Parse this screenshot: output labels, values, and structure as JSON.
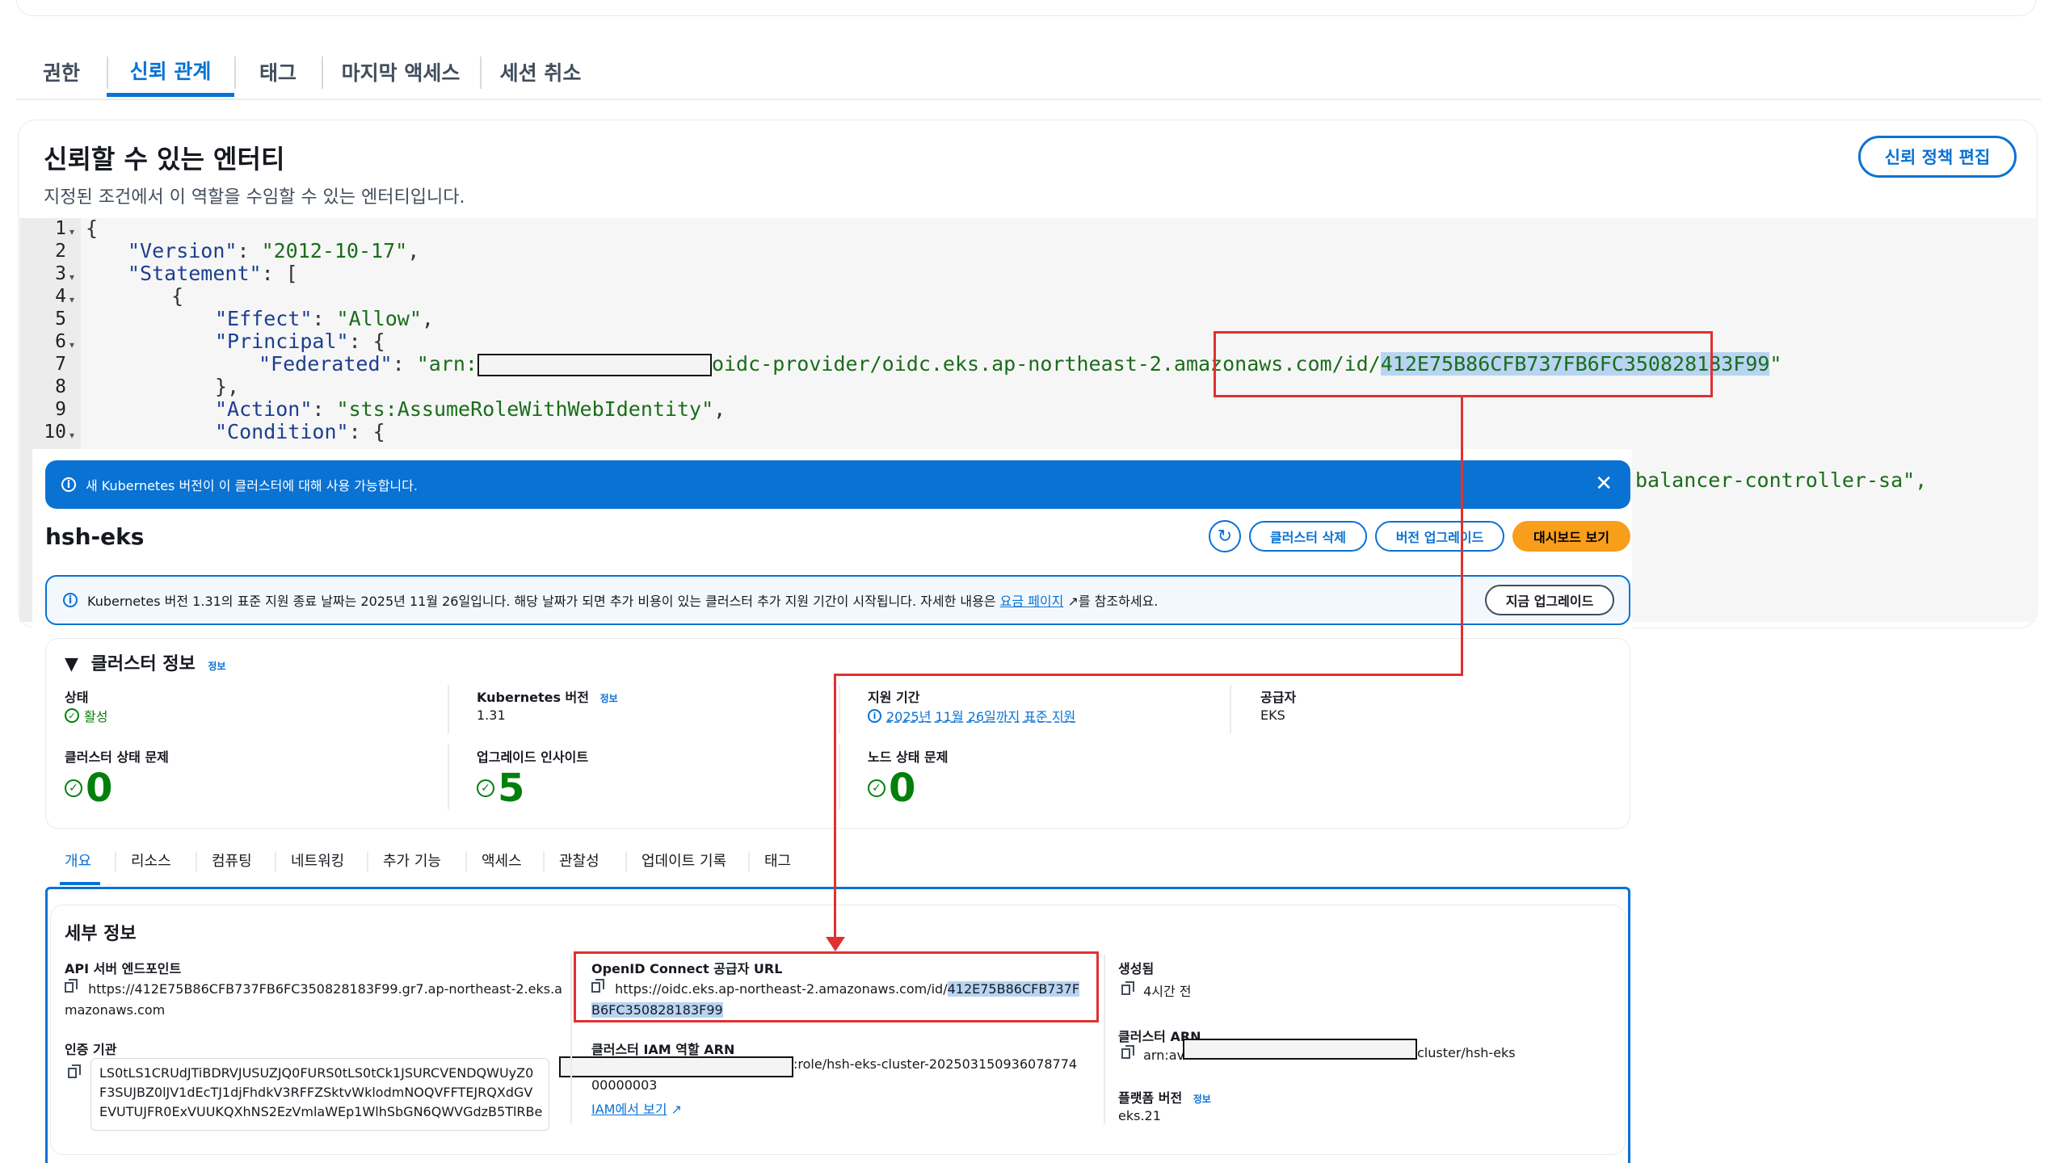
{
  "tabs": [
    {
      "label": "권한"
    },
    {
      "label": "신뢰 관계"
    },
    {
      "label": "태그"
    },
    {
      "label": "마지막 액세스"
    },
    {
      "label": "세션 취소"
    }
  ],
  "trusted": {
    "title": "신뢰할 수 있는 엔터티",
    "description": "지정된 조건에서 이 역할을 수임할 수 있는 엔터티입니다.",
    "edit_button": "신뢰 정책 편집"
  },
  "code": {
    "line_numbers": [
      "1",
      "2",
      "3",
      "4",
      "5",
      "6",
      "7",
      "8",
      "9",
      "10"
    ],
    "l1": "{",
    "l2_key": "\"Version\"",
    "l2_val": "\"2012-10-17\"",
    "l3_key": "\"Statement\"",
    "l3_rest": ": [",
    "l4": "{",
    "l5_key": "\"Effect\"",
    "l5_val": "\"Allow\"",
    "l6_key": "\"Principal\"",
    "l6_rest": ": {",
    "l7_key": "\"Federated\"",
    "l7_prefix": "\"arn:",
    "l7_mid": "oidc-provider/oidc.eks.ap-northeast-2.amazonaws.com/id/",
    "l7_id": "412E75B86CFB737FB6FC350828183F99",
    "l7_end": "\"",
    "l8": "},",
    "l9_key": "\"Action\"",
    "l9_val": "\"sts:AssumeRoleWithWebIdentity\"",
    "l10_key": "\"Condition\"",
    "l10_rest": ": {",
    "peek": "balancer-controller-sa\","
  },
  "eks": {
    "banner_text": "새 Kubernetes 버전이 이 클러스터에 대해 사용 가능합니다.",
    "cluster_name": "hsh-eks",
    "buttons": {
      "delete": "클러스터 삭제",
      "upgrade": "버전 업그레이드",
      "dashboard": "대시보드 보기",
      "upgrade_now": "지금 업그레이드"
    },
    "alert": {
      "text1": "Kubernetes 버전 1.31의 표준 지원 종료 날짜는 2025년 11월 26일입니다. 해당 날짜가 되면 추가 비용이 있는 클러스터 추가 지원 기간이 시작됩니다. 자세한 내용은 ",
      "link": "요금 페이지",
      "text2": "를 참조하세요."
    },
    "info_section": {
      "title": "클러스터 정보",
      "info": "정보",
      "status_label": "상태",
      "status_value": "활성",
      "k8s_label": "Kubernetes 버전",
      "k8s_info": "정보",
      "k8s_value": "1.31",
      "support_label": "지원 기간",
      "support_value": "2025년 11월 26일까지 표준 지원",
      "provider_label": "공급자",
      "provider_value": "EKS",
      "health_label": "클러스터 상태 문제",
      "health_value": "0",
      "insight_label": "업그레이드 인사이트",
      "insight_value": "5",
      "node_label": "노드 상태 문제",
      "node_value": "0"
    },
    "sub_tabs": [
      "개요",
      "리소스",
      "컴퓨팅",
      "네트워킹",
      "추가 기능",
      "액세스",
      "관찰성",
      "업데이트 기록",
      "태그"
    ],
    "details": {
      "title": "세부 정보",
      "api_label": "API 서버 엔드포인트",
      "api_line1": "https://412E75B86CFB737FB6FC350828183F99.gr7.ap-northeast-2.eks.a",
      "api_line2": "mazonaws.com",
      "oidc_label": "OpenID Connect 공급자 URL",
      "oidc_prefix": "https://oidc.eks.ap-northeast-2.amazonaws.com/id/",
      "oidc_id1": "412E75B86CFB737F",
      "oidc_id2": "B6FC350828183F99",
      "created_label": "생성됨",
      "created_value": "4시간 전",
      "auth_label": "인증 기관",
      "auth_lines": [
        "LS0tLS1CRUdJTiBDRVJUSUZJQ0FURS0tLS0tCk1JSURCVENDQWUyZ0",
        "F3SUJBZ0lJV1dEcTJ1djFhdkV3RFFZSktvWklodmNOQVFFTEJRQXdGV",
        "EVUTUJFR0ExVUUKQXhNS2EzVmlaWEp1WlhSbGN6QWVGdzB5TlRBe"
      ],
      "iam_label": "클러스터 IAM 역할 ARN",
      "iam_suffix": ":role/hsh-eks-cluster-202503150936078774",
      "iam_line2": "00000003",
      "iam_link": "IAM에서 보기",
      "arn_label": "클러스터 ARN",
      "arn_prefix": "arn:av",
      "arn_suffix": "cluster/hsh-eks",
      "platform_label": "플랫폼 버전",
      "platform_info": "정보",
      "platform_value": "eks.21"
    }
  },
  "colors": {
    "primary": "#0972d3",
    "success": "#037f0c",
    "annotation": "#e03030",
    "dashboard": "#f89e1b"
  }
}
